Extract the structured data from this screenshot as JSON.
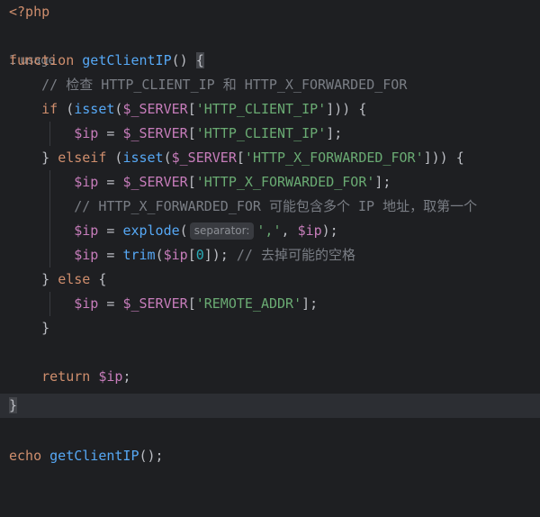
{
  "code": {
    "php_open": "<?php",
    "usage_hint": "1 usage",
    "kw_function": "function",
    "fn_name": "getClientIP",
    "sig_paren": "() ",
    "open_brace": "{",
    "comment_check": "// 检查 HTTP_CLIENT_IP 和 HTTP_X_FORWARDED_FOR",
    "kw_if": "if",
    "paren_isset_open": " (",
    "fn_isset": "isset",
    "paren_open": "(",
    "var_server": "$_SERVER",
    "bracket_open": "['",
    "str_client_ip": "HTTP_CLIENT_IP",
    "bracket_close_if": "'])) {",
    "var_ip": "$ip",
    "assign": " = ",
    "bracket_close_stmt": "'];",
    "close_brace": "} ",
    "kw_elseif": "elseif",
    "str_forwarded": "HTTP_X_FORWARDED_FOR",
    "comment_forwarded": "// HTTP_X_FORWARDED_FOR 可能包含多个 IP 地址，取第一个",
    "fn_explode": "explode",
    "param_hint": "separator:",
    "str_comma": "','",
    "explode_tail": ", ",
    "close_stmt": ");",
    "fn_trim": "trim",
    "idx_open": "[",
    "num_zero": "0",
    "idx_close": "]); ",
    "comment_trim": "// 去掉可能的空格",
    "kw_else": "else",
    "brace_only": "{",
    "brace_close": "}",
    "str_remote": "REMOTE_ADDR",
    "kw_return": "return",
    "semicolon": ";",
    "kw_echo": "echo",
    "call_tail": "();"
  },
  "colors": {
    "background": "#1e1f22",
    "keyword": "#cf8e6d",
    "function": "#56a8f5",
    "variable": "#c77dbb",
    "string": "#6aab73",
    "comment": "#7a7e85",
    "number": "#2aacb8",
    "text": "#bcbec4"
  }
}
